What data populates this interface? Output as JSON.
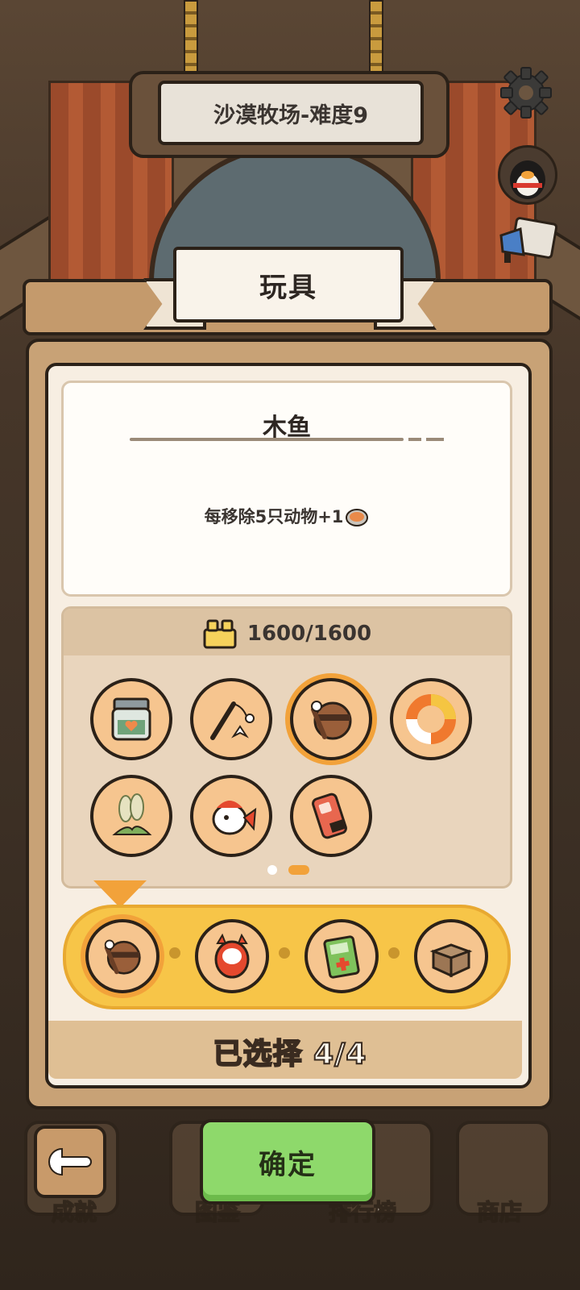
{
  "header": {
    "level_title": "沙漠牧场-难度9"
  },
  "icons": {
    "settings": "gear-icon",
    "avatar": "penguin-avatar-icon",
    "announce": "megaphone-icon"
  },
  "panel": {
    "title": "玩具",
    "item_name": "木鱼",
    "item_desc": "每移除5只动物+1",
    "currency_count": "1600/1600",
    "grid_items": [
      {
        "name": "fish-jar",
        "selected": false
      },
      {
        "name": "cat-teaser",
        "selected": false
      },
      {
        "name": "wooden-fish",
        "selected": true
      },
      {
        "name": "donut-ring",
        "selected": false
      },
      {
        "name": "dog-tail-grass",
        "selected": false
      },
      {
        "name": "goldfish",
        "selected": false
      },
      {
        "name": "phone-device",
        "selected": false
      }
    ],
    "pages": {
      "total": 2,
      "current": 2
    }
  },
  "selected_bar": {
    "slots": [
      "wooden-fish",
      "cat-doll",
      "first-aid-box",
      "cardboard-box"
    ],
    "summary": "已选择 4/4"
  },
  "nav": {
    "achievements": "成就",
    "encyclopedia": "图鉴",
    "leaderboard": "排行榜",
    "shop": "商店",
    "confirm": "确定"
  },
  "colors": {
    "accent": "#f2a23a",
    "confirm": "#8ed96b",
    "panel": "#c8a276"
  }
}
